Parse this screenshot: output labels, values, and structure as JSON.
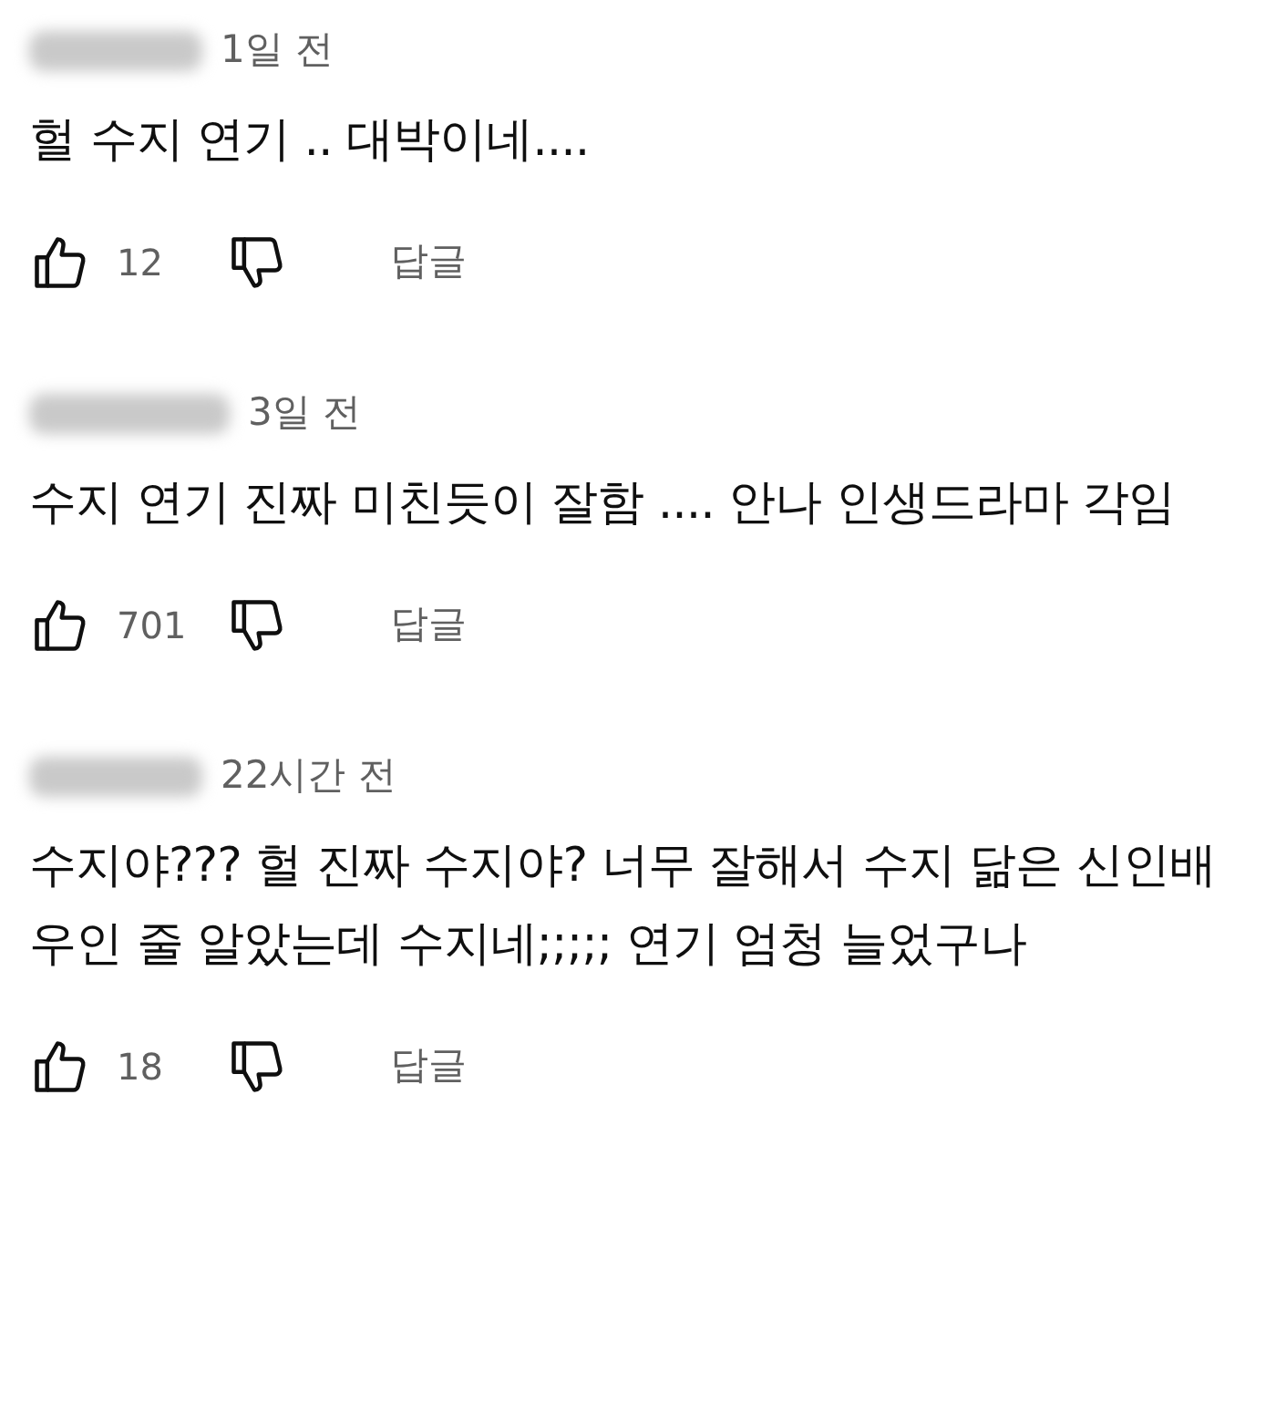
{
  "comments": [
    {
      "time": "1일 전",
      "text": "헐 수지 연기 .. 대박이네....",
      "likes": "12",
      "reply": "답글"
    },
    {
      "time": "3일 전",
      "text": "수지 연기 진짜 미친듯이 잘함 .... 안나 인생드라마 각임",
      "likes": "701",
      "reply": "답글"
    },
    {
      "time": "22시간 전",
      "text": "수지야??? 헐 진짜 수지야? 너무 잘해서 수지 닮은 신인배우인 줄 알았는데 수지네;;;;; 연기 엄청 늘었구나",
      "likes": "18",
      "reply": "답글"
    }
  ]
}
